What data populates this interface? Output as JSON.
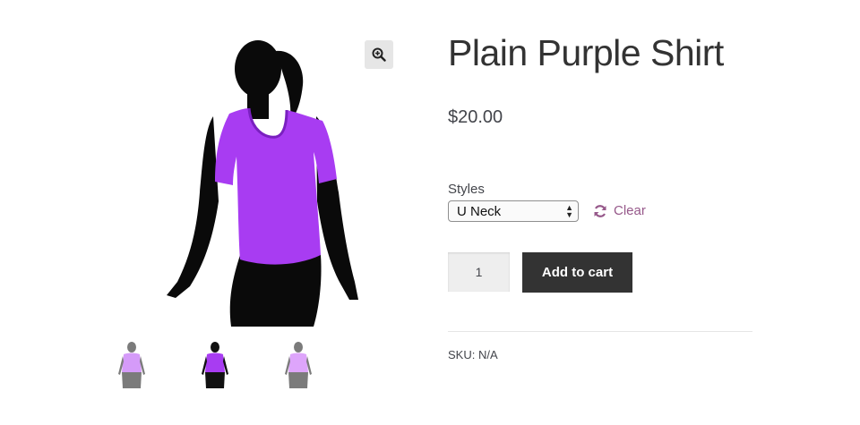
{
  "product": {
    "title": "Plain Purple Shirt",
    "price": "$20.00",
    "sku_label": "SKU:",
    "sku_value": "N/A"
  },
  "variation": {
    "label": "Styles",
    "selected": "U Neck",
    "clear_label": "Clear"
  },
  "cart": {
    "quantity": "1",
    "add_label": "Add to cart"
  },
  "gallery": {
    "zoom_icon": "magnifier-plus-icon",
    "thumbnail_count": 3,
    "active_thumbnail": 2
  },
  "colors": {
    "shirt": "#a83cf2",
    "accent_link": "#96588a",
    "button_bg": "#333333"
  }
}
